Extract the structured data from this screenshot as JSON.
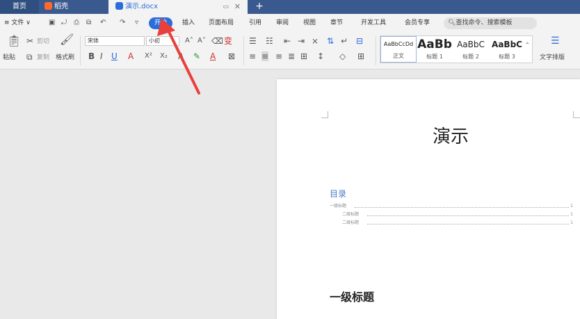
{
  "titlebar": {
    "home_tab": "首页",
    "tabs": [
      {
        "label": "稻壳"
      },
      {
        "label": "演示.docx"
      }
    ],
    "new_tab": "+"
  },
  "menu": {
    "file": "≡ 文件 ∨",
    "items": [
      "插入",
      "页面布局",
      "引用",
      "审阅",
      "视图",
      "章节",
      "开发工具",
      "会员专享"
    ],
    "active": "开始",
    "search_placeholder": "查找命令、搜索模板"
  },
  "ribbon": {
    "paste": "粘贴",
    "cut": "剪切",
    "copy": "复制",
    "format_painter": "格式刷",
    "font_name": "宋体",
    "font_size": "小初",
    "text_layout": "文字排版",
    "styles": [
      {
        "sample": "AaBbCcDd",
        "label": "正文"
      },
      {
        "sample": "AaBb",
        "label": "标题 1"
      },
      {
        "sample": "AaBbC",
        "label": "标题 2"
      },
      {
        "sample": "AaBbC",
        "label": "标题 3"
      }
    ]
  },
  "document": {
    "title": "演示",
    "toc_heading": "目录",
    "toc": [
      {
        "text": "一级标题",
        "page": "1",
        "level": 1
      },
      {
        "text": "二级标题",
        "page": "1",
        "level": 2
      },
      {
        "text": "二级标题",
        "page": "1",
        "level": 2
      }
    ],
    "heading1": "一级标题"
  },
  "colors": {
    "titlebar": "#3a5a8f",
    "accent": "#2b6ddb",
    "arrow": "#e8403a",
    "toc_heading": "#4a79c7"
  }
}
